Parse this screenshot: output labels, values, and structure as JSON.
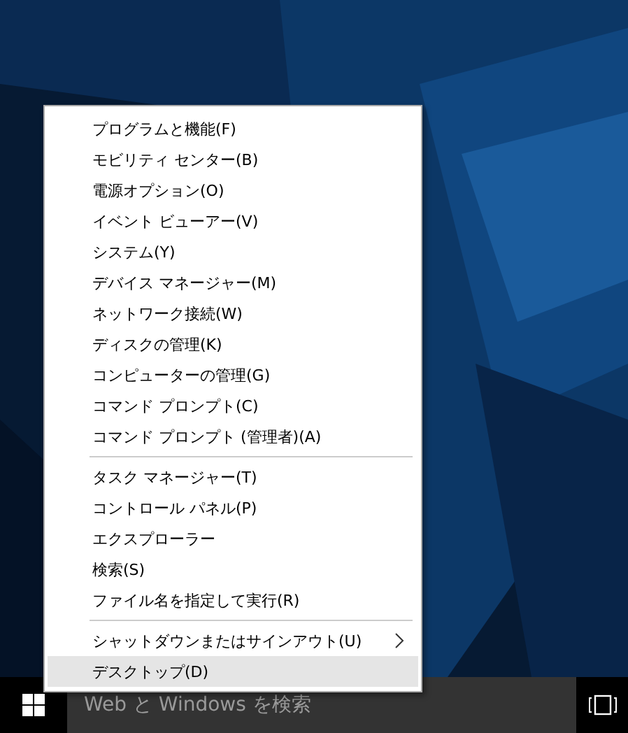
{
  "menu": {
    "groups": [
      {
        "items": [
          {
            "label": "プログラムと機能(F)",
            "selected": false,
            "submenu": false
          },
          {
            "label": "モビリティ センター(B)",
            "selected": false,
            "submenu": false
          },
          {
            "label": "電源オプション(O)",
            "selected": false,
            "submenu": false
          },
          {
            "label": "イベント ビューアー(V)",
            "selected": false,
            "submenu": false
          },
          {
            "label": "システム(Y)",
            "selected": false,
            "submenu": false
          },
          {
            "label": "デバイス マネージャー(M)",
            "selected": false,
            "submenu": false
          },
          {
            "label": "ネットワーク接続(W)",
            "selected": false,
            "submenu": false
          },
          {
            "label": "ディスクの管理(K)",
            "selected": false,
            "submenu": false
          },
          {
            "label": "コンピューターの管理(G)",
            "selected": false,
            "submenu": false
          },
          {
            "label": "コマンド プロンプト(C)",
            "selected": false,
            "submenu": false
          },
          {
            "label": "コマンド プロンプト (管理者)(A)",
            "selected": false,
            "submenu": false
          }
        ]
      },
      {
        "items": [
          {
            "label": "タスク マネージャー(T)",
            "selected": false,
            "submenu": false
          },
          {
            "label": "コントロール パネル(P)",
            "selected": false,
            "submenu": false
          },
          {
            "label": "エクスプローラー",
            "selected": false,
            "submenu": false
          },
          {
            "label": "検索(S)",
            "selected": false,
            "submenu": false
          },
          {
            "label": "ファイル名を指定して実行(R)",
            "selected": false,
            "submenu": false
          }
        ]
      },
      {
        "items": [
          {
            "label": "シャットダウンまたはサインアウト(U)",
            "selected": false,
            "submenu": true
          },
          {
            "label": "デスクトップ(D)",
            "selected": true,
            "submenu": false
          }
        ]
      }
    ]
  },
  "taskbar": {
    "search": {
      "placeholder": "Web と Windows を検索"
    }
  }
}
